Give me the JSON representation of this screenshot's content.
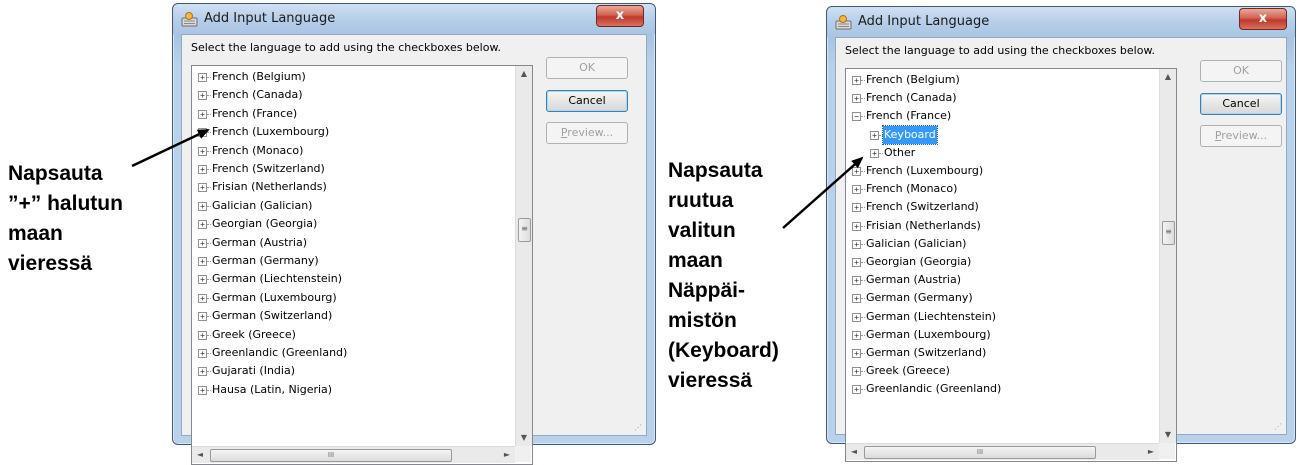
{
  "dialog_title": "Add Input Language",
  "prompt": "Select the language to add using the checkboxes below.",
  "buttons": {
    "ok": "OK",
    "cancel": "Cancel",
    "preview_prefix": "P",
    "preview_rest": "review..."
  },
  "close_glyph": "x",
  "scrollbar": {
    "up": "▲",
    "down": "▼",
    "left": "◄",
    "right": "►",
    "vthumb": "≡",
    "hthumb": "III"
  },
  "expander": {
    "collapsed": "+",
    "expanded": "−"
  },
  "annotation_left": [
    "Napsauta",
    "”+” halutun",
    "maan",
    "vieressä"
  ],
  "annotation_right": [
    "Napsauta",
    "ruutua",
    "valitun",
    "maan",
    "Näppäi-",
    "mistön",
    "(Keyboard)",
    "vieressä"
  ],
  "dialog_left": {
    "items": [
      {
        "label": "French (Belgium)",
        "level": 0,
        "state": "collapsed"
      },
      {
        "label": "French (Canada)",
        "level": 0,
        "state": "collapsed"
      },
      {
        "label": "French (France)",
        "level": 0,
        "state": "collapsed"
      },
      {
        "label": "French (Luxembourg)",
        "level": 0,
        "state": "collapsed"
      },
      {
        "label": "French (Monaco)",
        "level": 0,
        "state": "collapsed"
      },
      {
        "label": "French (Switzerland)",
        "level": 0,
        "state": "collapsed"
      },
      {
        "label": "Frisian (Netherlands)",
        "level": 0,
        "state": "collapsed"
      },
      {
        "label": "Galician (Galician)",
        "level": 0,
        "state": "collapsed"
      },
      {
        "label": "Georgian (Georgia)",
        "level": 0,
        "state": "collapsed"
      },
      {
        "label": "German (Austria)",
        "level": 0,
        "state": "collapsed"
      },
      {
        "label": "German (Germany)",
        "level": 0,
        "state": "collapsed"
      },
      {
        "label": "German (Liechtenstein)",
        "level": 0,
        "state": "collapsed"
      },
      {
        "label": "German (Luxembourg)",
        "level": 0,
        "state": "collapsed"
      },
      {
        "label": "German (Switzerland)",
        "level": 0,
        "state": "collapsed"
      },
      {
        "label": "Greek (Greece)",
        "level": 0,
        "state": "collapsed"
      },
      {
        "label": "Greenlandic (Greenland)",
        "level": 0,
        "state": "collapsed"
      },
      {
        "label": "Gujarati (India)",
        "level": 0,
        "state": "collapsed"
      },
      {
        "label": "Hausa (Latin, Nigeria)",
        "level": 0,
        "state": "collapsed"
      }
    ]
  },
  "dialog_right": {
    "items": [
      {
        "label": "French (Belgium)",
        "level": 0,
        "state": "collapsed"
      },
      {
        "label": "French (Canada)",
        "level": 0,
        "state": "collapsed"
      },
      {
        "label": "French (France)",
        "level": 0,
        "state": "expanded"
      },
      {
        "label": "Keyboard",
        "level": 1,
        "state": "collapsed",
        "selected": true
      },
      {
        "label": "Other",
        "level": 1,
        "state": "collapsed"
      },
      {
        "label": "French (Luxembourg)",
        "level": 0,
        "state": "collapsed"
      },
      {
        "label": "French (Monaco)",
        "level": 0,
        "state": "collapsed"
      },
      {
        "label": "French (Switzerland)",
        "level": 0,
        "state": "collapsed"
      },
      {
        "label": "Frisian (Netherlands)",
        "level": 0,
        "state": "collapsed"
      },
      {
        "label": "Galician (Galician)",
        "level": 0,
        "state": "collapsed"
      },
      {
        "label": "Georgian (Georgia)",
        "level": 0,
        "state": "collapsed"
      },
      {
        "label": "German (Austria)",
        "level": 0,
        "state": "collapsed"
      },
      {
        "label": "German (Germany)",
        "level": 0,
        "state": "collapsed"
      },
      {
        "label": "German (Liechtenstein)",
        "level": 0,
        "state": "collapsed"
      },
      {
        "label": "German (Luxembourg)",
        "level": 0,
        "state": "collapsed"
      },
      {
        "label": "German (Switzerland)",
        "level": 0,
        "state": "collapsed"
      },
      {
        "label": "Greek (Greece)",
        "level": 0,
        "state": "collapsed"
      },
      {
        "label": "Greenlandic (Greenland)",
        "level": 0,
        "state": "collapsed"
      }
    ]
  }
}
